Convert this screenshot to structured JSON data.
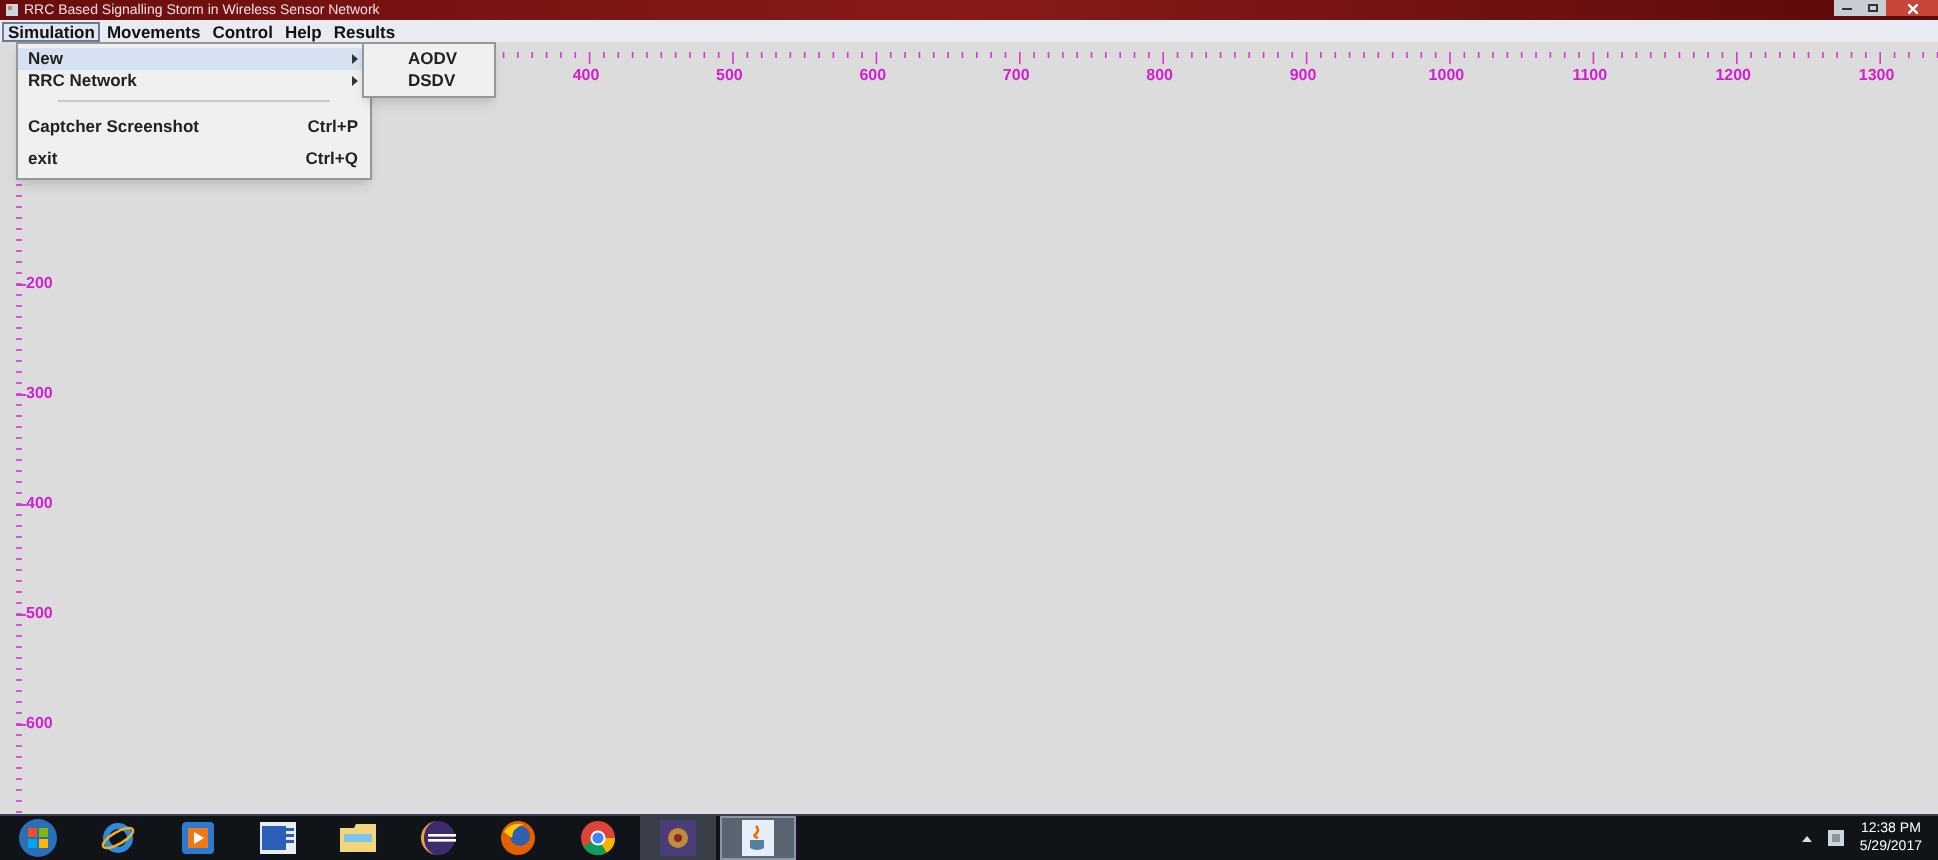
{
  "window": {
    "title": "RRC Based Signalling Storm in Wireless Sensor Network"
  },
  "menu_bar": [
    {
      "label": "Simulation",
      "selected": true
    },
    {
      "label": "Movements",
      "selected": false
    },
    {
      "label": "Control",
      "selected": false
    },
    {
      "label": "Help",
      "selected": false
    },
    {
      "label": "Results",
      "selected": false
    }
  ],
  "dropdown": {
    "items": [
      {
        "kind": "submenu",
        "label": "New",
        "selected": true
      },
      {
        "kind": "submenu",
        "label": "RRC Network",
        "selected": false
      },
      {
        "kind": "separator"
      },
      {
        "kind": "command",
        "label": "Captcher Screenshot",
        "shortcut": "Ctrl+P",
        "selected": false
      },
      {
        "kind": "command",
        "label": "exit",
        "shortcut": "Ctrl+Q",
        "selected": false
      }
    ]
  },
  "submenu": {
    "items": [
      {
        "label": "AODV"
      },
      {
        "label": "DSDV"
      }
    ]
  },
  "ruler": {
    "x_labels": [
      "400",
      "500",
      "600",
      "700",
      "800",
      "900",
      "1000",
      "1100",
      "1200",
      "1300"
    ],
    "y_labels": [
      "200",
      "300",
      "400",
      "500",
      "600"
    ]
  },
  "taskbar": {
    "apps": [
      {
        "kind": "start",
        "selected": false
      },
      {
        "kind": "ie",
        "selected": false
      },
      {
        "kind": "media",
        "selected": false
      },
      {
        "kind": "word",
        "selected": false
      },
      {
        "kind": "folder",
        "selected": false
      },
      {
        "kind": "eclipse",
        "selected": false
      },
      {
        "kind": "firefox",
        "selected": false
      },
      {
        "kind": "chrome",
        "selected": false
      },
      {
        "kind": "app",
        "selected": false
      },
      {
        "kind": "java",
        "selected": true
      }
    ],
    "time": "12:38 PM",
    "date": "5/29/2017"
  }
}
